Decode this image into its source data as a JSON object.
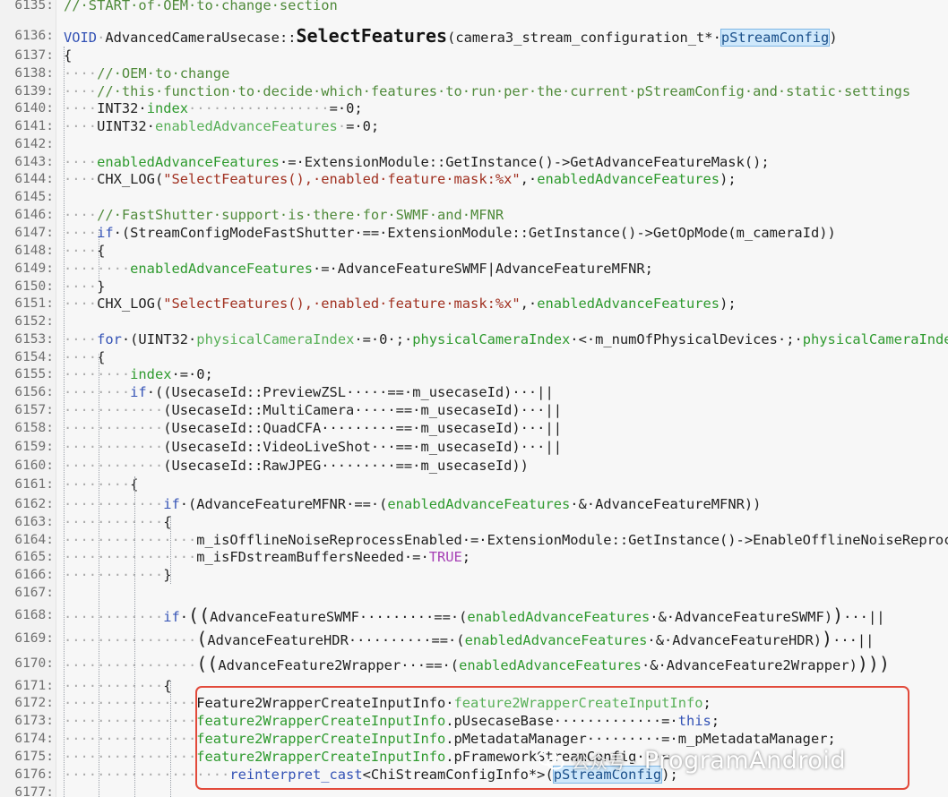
{
  "editor": {
    "lines": [
      {
        "n": "6135:",
        "segs": [
          [
            "//·START·of·OEM·to·change·section",
            "cm"
          ]
        ]
      },
      {
        "n": "6136:",
        "segs": [
          [
            "VOID",
            "kw"
          ],
          [
            "·",
            "ws"
          ],
          [
            "AdvancedCameraUsecase::",
            ""
          ],
          [
            "SelectFeatures",
            "fn"
          ],
          [
            "(camera3_stream_configuration_t*·",
            ""
          ],
          [
            "pStreamConfig",
            "hl"
          ],
          [
            ")",
            ""
          ]
        ]
      },
      {
        "n": "6137:",
        "segs": [
          [
            "{",
            ""
          ]
        ]
      },
      {
        "n": "6138:",
        "segs": [
          [
            "····",
            "ws"
          ],
          [
            "//·OEM·to·change",
            "cm"
          ]
        ]
      },
      {
        "n": "6139:",
        "segs": [
          [
            "····",
            "ws"
          ],
          [
            "//·this·function·to·decide·which·features·to·run·per·the·current·pStreamConfig·and·static·settings",
            "cm"
          ]
        ]
      },
      {
        "n": "6140:",
        "segs": [
          [
            "····",
            "ws"
          ],
          [
            "INT32·",
            ""
          ],
          [
            "index",
            "va"
          ],
          [
            "·················",
            "ws"
          ],
          [
            "=·0;",
            ""
          ]
        ]
      },
      {
        "n": "6141:",
        "segs": [
          [
            "····",
            "ws"
          ],
          [
            "UINT32·",
            ""
          ],
          [
            "enabledAdvanceFeatures",
            "mu"
          ],
          [
            "·",
            "ws"
          ],
          [
            "=·0;",
            ""
          ]
        ]
      },
      {
        "n": "6142:",
        "segs": []
      },
      {
        "n": "6143:",
        "segs": [
          [
            "····",
            "ws"
          ],
          [
            "enabledAdvanceFeatures",
            "va"
          ],
          [
            "·=·ExtensionModule::GetInstance()->GetAdvanceFeatureMask();",
            ""
          ]
        ]
      },
      {
        "n": "6144:",
        "segs": [
          [
            "····",
            "ws"
          ],
          [
            "CHX_LOG(",
            ""
          ],
          [
            "\"SelectFeatures(),·enabled·feature·mask:%x\"",
            "st"
          ],
          [
            ",·",
            ""
          ],
          [
            "enabledAdvanceFeatures",
            "va"
          ],
          [
            ");",
            ""
          ]
        ]
      },
      {
        "n": "6145:",
        "segs": []
      },
      {
        "n": "6146:",
        "segs": [
          [
            "····",
            "ws"
          ],
          [
            "//·FastShutter·support·is·there·for·SWMF·and·MFNR",
            "cm"
          ]
        ]
      },
      {
        "n": "6147:",
        "segs": [
          [
            "····",
            "ws"
          ],
          [
            "if",
            "kw"
          ],
          [
            "·(StreamConfigModeFastShutter·==·ExtensionModule::GetInstance()->GetOpMode(m_cameraId))",
            ""
          ]
        ]
      },
      {
        "n": "6148:",
        "segs": [
          [
            "····",
            "ws"
          ],
          [
            "{",
            ""
          ]
        ]
      },
      {
        "n": "6149:",
        "segs": [
          [
            "········",
            "ws"
          ],
          [
            "enabledAdvanceFeatures",
            "va"
          ],
          [
            "·=·AdvanceFeatureSWMF|AdvanceFeatureMFNR;",
            ""
          ]
        ]
      },
      {
        "n": "6150:",
        "segs": [
          [
            "····",
            "ws"
          ],
          [
            "}",
            ""
          ]
        ]
      },
      {
        "n": "6151:",
        "segs": [
          [
            "····",
            "ws"
          ],
          [
            "CHX_LOG(",
            ""
          ],
          [
            "\"SelectFeatures(),·enabled·feature·mask:%x\"",
            "st"
          ],
          [
            ",·",
            ""
          ],
          [
            "enabledAdvanceFeatures",
            "va"
          ],
          [
            ");",
            ""
          ]
        ]
      },
      {
        "n": "6152:",
        "segs": []
      },
      {
        "n": "6153:",
        "segs": [
          [
            "····",
            "ws"
          ],
          [
            "for",
            "kw"
          ],
          [
            "·(UINT32·",
            ""
          ],
          [
            "physicalCameraIndex",
            "mu"
          ],
          [
            "·=·0·;·",
            ""
          ],
          [
            "physicalCameraIndex",
            "va"
          ],
          [
            "·<·m_numOfPhysicalDevices·;·",
            ""
          ],
          [
            "physicalCameraIndex++)",
            "va"
          ]
        ]
      },
      {
        "n": "6154:",
        "segs": [
          [
            "····",
            "ws"
          ],
          [
            "{",
            ""
          ]
        ]
      },
      {
        "n": "6155:",
        "segs": [
          [
            "········",
            "ws"
          ],
          [
            "index",
            "va"
          ],
          [
            "·=·0;",
            ""
          ]
        ]
      },
      {
        "n": "6156:",
        "segs": [
          [
            "········",
            "ws"
          ],
          [
            "if",
            "kw"
          ],
          [
            "·((UsecaseId::PreviewZSL·····==·m_usecaseId)···||",
            ""
          ]
        ]
      },
      {
        "n": "6157:",
        "segs": [
          [
            "············",
            "ws"
          ],
          [
            "(UsecaseId::MultiCamera·····==·m_usecaseId)···||",
            ""
          ]
        ]
      },
      {
        "n": "6158:",
        "segs": [
          [
            "············",
            "ws"
          ],
          [
            "(UsecaseId::QuadCFA·········==·m_usecaseId)···||",
            ""
          ]
        ]
      },
      {
        "n": "6159:",
        "segs": [
          [
            "············",
            "ws"
          ],
          [
            "(UsecaseId::VideoLiveShot···==·m_usecaseId)···||",
            ""
          ]
        ]
      },
      {
        "n": "6160:",
        "segs": [
          [
            "············",
            "ws"
          ],
          [
            "(UsecaseId::RawJPEG·········==·m_usecaseId))",
            ""
          ]
        ]
      },
      {
        "n": "6161:",
        "segs": [
          [
            "········",
            "ws"
          ],
          [
            "{",
            ""
          ]
        ]
      },
      {
        "n": "6162:",
        "segs": [
          [
            "············",
            "ws"
          ],
          [
            "if",
            "kw"
          ],
          [
            "·(AdvanceFeatureMFNR·==·(",
            ""
          ],
          [
            "enabledAdvanceFeatures",
            "va"
          ],
          [
            "·&·AdvanceFeatureMFNR))",
            ""
          ]
        ]
      },
      {
        "n": "6163:",
        "segs": [
          [
            "············",
            "ws"
          ],
          [
            "{",
            ""
          ]
        ]
      },
      {
        "n": "6164:",
        "segs": [
          [
            "················",
            "ws"
          ],
          [
            "m_isOfflineNoiseReprocessEnabled·=·ExtensionModule::GetInstance()->EnableOfflineNoiseReprocessing();",
            ""
          ]
        ]
      },
      {
        "n": "6165:",
        "segs": [
          [
            "················",
            "ws"
          ],
          [
            "m_isFDstreamBuffersNeeded·=·",
            ""
          ],
          [
            "TRUE",
            "tr"
          ],
          [
            ";",
            ""
          ]
        ]
      },
      {
        "n": "6166:",
        "segs": [
          [
            "············",
            "ws"
          ],
          [
            "}",
            ""
          ]
        ]
      },
      {
        "n": "6167:",
        "segs": []
      },
      {
        "n": "6168:",
        "segs": [
          [
            "············",
            "ws"
          ],
          [
            "if",
            "kw"
          ],
          [
            "·",
            ""
          ],
          [
            "((",
            "bg"
          ],
          [
            "AdvanceFeatureSWMF·········==·(",
            ""
          ],
          [
            "enabledAdvanceFeatures",
            "va"
          ],
          [
            "·&·AdvanceFeatureSWMF)",
            ""
          ],
          [
            ")",
            "bg"
          ],
          [
            "···||",
            ""
          ]
        ]
      },
      {
        "n": "6169:",
        "segs": [
          [
            "················",
            "ws"
          ],
          [
            "(",
            "bg"
          ],
          [
            "AdvanceFeatureHDR··········==·(",
            ""
          ],
          [
            "enabledAdvanceFeatures",
            "va"
          ],
          [
            "·&·AdvanceFeatureHDR)",
            ""
          ],
          [
            ")",
            "bg"
          ],
          [
            "···||",
            ""
          ]
        ]
      },
      {
        "n": "6170:",
        "segs": [
          [
            "················",
            "ws"
          ],
          [
            "((",
            "bg"
          ],
          [
            "AdvanceFeature2Wrapper···==·(",
            ""
          ],
          [
            "enabledAdvanceFeatures",
            "va"
          ],
          [
            "·&·AdvanceFeature2Wrapper)",
            ""
          ],
          [
            ")))",
            "bg"
          ]
        ]
      },
      {
        "n": "6171:",
        "segs": [
          [
            "············",
            "ws"
          ],
          [
            "{",
            ""
          ]
        ]
      },
      {
        "n": "6172:",
        "segs": [
          [
            "················",
            "ws"
          ],
          [
            "Feature2WrapperCreateInputInfo·",
            ""
          ],
          [
            "feature2WrapperCreateInputInfo",
            "mu"
          ],
          [
            ";",
            ""
          ]
        ]
      },
      {
        "n": "6173:",
        "segs": [
          [
            "················",
            "ws"
          ],
          [
            "feature2WrapperCreateInputInfo",
            "va"
          ],
          [
            ".pUsecaseBase·············=·",
            ""
          ],
          [
            "this",
            "kw"
          ],
          [
            ";",
            ""
          ]
        ]
      },
      {
        "n": "6174:",
        "segs": [
          [
            "················",
            "ws"
          ],
          [
            "feature2WrapperCreateInputInfo",
            "va"
          ],
          [
            ".pMetadataManager·········=·m_pMetadataManager;",
            ""
          ]
        ]
      },
      {
        "n": "6175:",
        "segs": [
          [
            "················",
            "ws"
          ],
          [
            "feature2WrapperCreateInputInfo",
            "va"
          ],
          [
            ".pFrameworkStreamConfig···=",
            ""
          ]
        ]
      },
      {
        "n": "6176:",
        "segs": [
          [
            "····················",
            "ws"
          ],
          [
            "reinterpret_cast",
            "kw"
          ],
          [
            "<ChiStreamConfigInfo*>(",
            ""
          ],
          [
            "pStreamConfig",
            "hl"
          ],
          [
            ");",
            ""
          ]
        ]
      },
      {
        "n": "6177:",
        "segs": []
      }
    ]
  },
  "watermark": {
    "icon": "wechat-icon",
    "prefix": "公众号 ·",
    "text": "ProgramAndroid"
  },
  "colors": {
    "comment": "#4f8a3a",
    "keyword": "#3352b5",
    "variable": "#2e9a2e",
    "string": "#a03020",
    "highlight": "#cfe8fb",
    "callout": "#e24a3b"
  }
}
